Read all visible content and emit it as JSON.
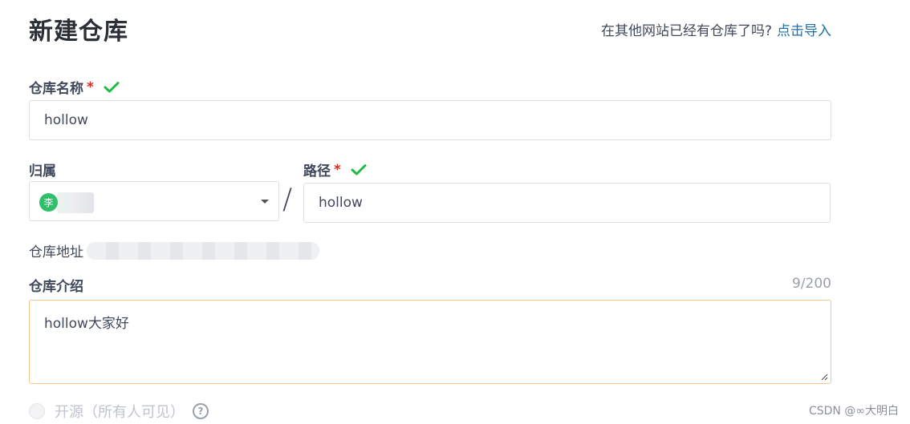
{
  "header": {
    "title": "新建仓库",
    "import_prompt": "在其他网站已经有仓库了吗?",
    "import_link": "点击导入"
  },
  "form": {
    "repo_name": {
      "label": "仓库名称",
      "required_mark": "*",
      "value": "hollow"
    },
    "owner": {
      "label": "归属",
      "avatar_text": "李"
    },
    "separator": "/",
    "path": {
      "label": "路径",
      "required_mark": "*",
      "value": "hollow"
    },
    "repo_address": {
      "label": "仓库地址"
    },
    "description": {
      "label": "仓库介绍",
      "counter": "9/200",
      "value": "hollow大家好"
    },
    "open_source": {
      "label": "开源（所有人可见）",
      "help_icon_text": "?"
    }
  },
  "watermark": "CSDN @∞大明白",
  "colors": {
    "check_green": "#21ba45",
    "required_red": "#db2828",
    "link_blue": "#1f6fa8",
    "textarea_focus_border": "#f2c690",
    "avatar_green": "#2fbf6a"
  },
  "icons": {
    "valid": "check-icon",
    "owner_dropdown": "caret-down-icon",
    "help": "question-circle-icon",
    "textarea_resize": "resize-handle-icon"
  }
}
